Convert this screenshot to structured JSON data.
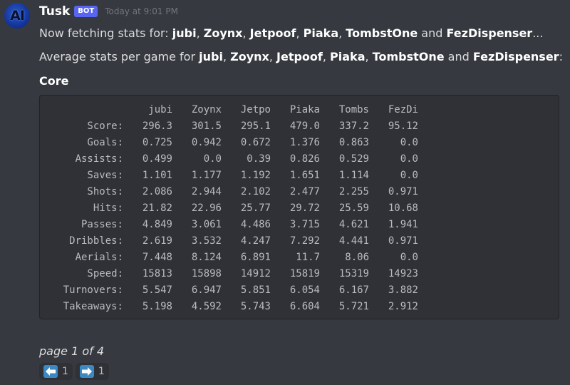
{
  "message": {
    "avatar_text": "AI",
    "username": "Tusk",
    "bot_tag": "BOT",
    "timestamp": "Today at 9:01 PM",
    "line1": {
      "prefix": "Now fetching stats for: ",
      "suffix": "..."
    },
    "line2": {
      "prefix": "Average stats per game for ",
      "suffix": ":"
    },
    "players": [
      "jubi",
      "Zoynx",
      "Jetpoof",
      "Piaka",
      "TombstOne",
      "FezDispenser"
    ],
    "separator": ", ",
    "conjunction": " and ",
    "section_title": "Core"
  },
  "stats_table": {
    "columns": [
      "jubi",
      "Zoynx",
      "Jetpo",
      "Piaka",
      "Tombs",
      "FezDi"
    ],
    "rows": [
      {
        "label": "Score:",
        "values": [
          "296.3",
          "301.5",
          "295.1",
          "479.0",
          "337.2",
          "95.12"
        ]
      },
      {
        "label": "Goals:",
        "values": [
          "0.725",
          "0.942",
          "0.672",
          "1.376",
          "0.863",
          "0.0"
        ]
      },
      {
        "label": "Assists:",
        "values": [
          "0.499",
          "0.0",
          "0.39",
          "0.826",
          "0.529",
          "0.0"
        ]
      },
      {
        "label": "Saves:",
        "values": [
          "1.101",
          "1.177",
          "1.192",
          "1.651",
          "1.114",
          "0.0"
        ]
      },
      {
        "label": "Shots:",
        "values": [
          "2.086",
          "2.944",
          "2.102",
          "2.477",
          "2.255",
          "0.971"
        ]
      },
      {
        "label": "Hits:",
        "values": [
          "21.82",
          "22.96",
          "25.77",
          "29.72",
          "25.59",
          "10.68"
        ]
      },
      {
        "label": "Passes:",
        "values": [
          "4.849",
          "3.061",
          "4.486",
          "3.715",
          "4.621",
          "1.941"
        ]
      },
      {
        "label": "Dribbles:",
        "values": [
          "2.619",
          "3.532",
          "4.247",
          "7.292",
          "4.441",
          "0.971"
        ]
      },
      {
        "label": "Aerials:",
        "values": [
          "7.448",
          "8.124",
          "6.891",
          "11.7",
          "8.06",
          "0.0"
        ]
      },
      {
        "label": "Speed:",
        "values": [
          "15813",
          "15898",
          "14912",
          "15819",
          "15319",
          "14923"
        ]
      },
      {
        "label": "Turnovers:",
        "values": [
          "5.547",
          "6.947",
          "5.851",
          "6.054",
          "6.167",
          "3.882"
        ]
      },
      {
        "label": "Takeaways:",
        "values": [
          "5.198",
          "4.592",
          "5.743",
          "6.604",
          "5.721",
          "2.912"
        ]
      }
    ]
  },
  "pagination": {
    "page_label": "page 1 of 4"
  },
  "reactions": [
    {
      "icon": "arrow-left-icon",
      "count": "1",
      "color": "#3b88c3"
    },
    {
      "icon": "arrow-right-icon",
      "count": "1",
      "color": "#3b88c3"
    }
  ],
  "colors": {
    "background": "#36393f",
    "codeblock": "#2f3136",
    "bot_tag": "#5865f2",
    "username": "#ffffff",
    "timestamp": "#72767d"
  }
}
